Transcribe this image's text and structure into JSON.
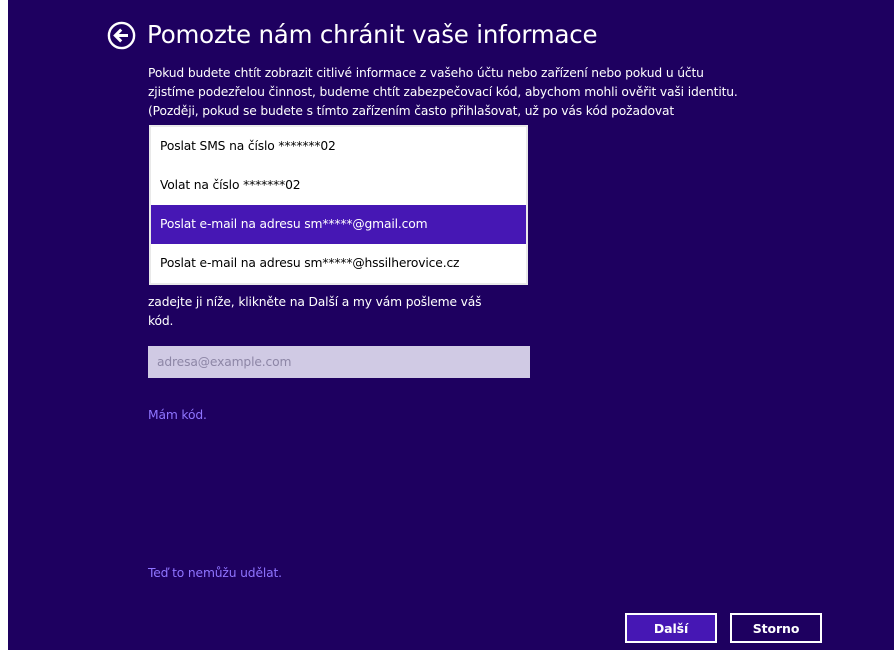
{
  "header": {
    "title": "Pomozte nám chránit vaše informace"
  },
  "description": {
    "lines": [
      "Pokud budete chtít zobrazit citlivé informace z vašeho účtu nebo zařízení nebo pokud u účtu",
      "zjistíme podezřelou činnost, budeme chtít zabezpečovací kód, abychom mohli ověřit vaši identitu.",
      "(Později, pokud se budete s tímto zařízením často přihlašovat, už po vás kód požadovat"
    ]
  },
  "dropdown": {
    "options": [
      "Poslat SMS na číslo *******02",
      "Volat na číslo *******02",
      "Poslat e-mail na adresu sm*****@gmail.com",
      "Poslat e-mail na adresu sm*****@hssilherovice.cz"
    ],
    "selected_index": 2
  },
  "instruction": {
    "lines": [
      "zadejte ji níže, klikněte na Další a my vám pošleme váš",
      "kód."
    ]
  },
  "email_input": {
    "value": "",
    "placeholder": "adresa@example.com"
  },
  "links": {
    "have_code": "Mám kód.",
    "cant_now": "Teď to nemůžu udělat."
  },
  "buttons": {
    "next": "Další",
    "cancel": "Storno"
  },
  "icons": {
    "back": "back-arrow-circle-icon"
  },
  "colors": {
    "background": "#1e0060",
    "accent": "#4617b4",
    "link": "#8f74ff",
    "input_background": "#d0cae4"
  }
}
